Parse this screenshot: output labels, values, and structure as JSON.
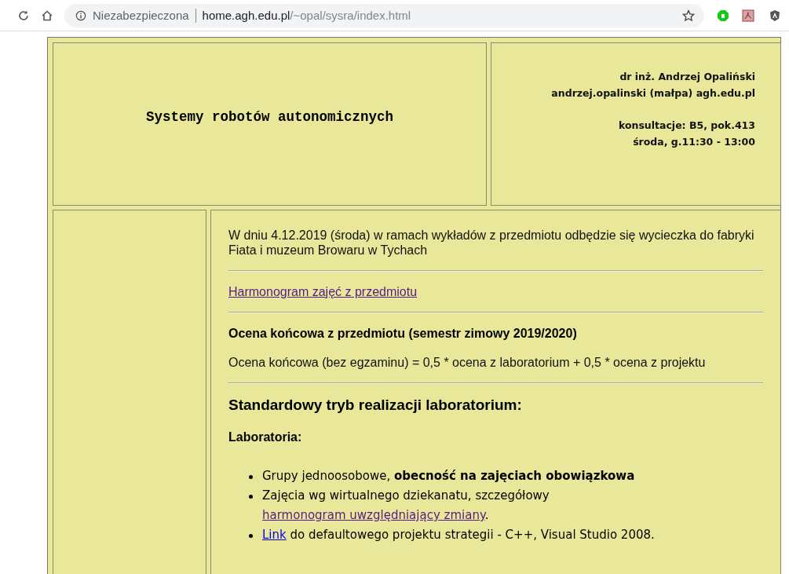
{
  "browser": {
    "security_label": "Niezabezpieczona",
    "url_host": "home.agh.edu.pl",
    "url_path": "/~opal/sysra/index.html"
  },
  "header": {
    "title": "Systemy robotów autonomicznych",
    "contact": [
      "dr inż. Andrzej Opaliński",
      "andrzej.opalinski (małpa) agh.edu.pl"
    ],
    "office_hours": [
      "konsultacje: B5, pok.413",
      "środa, g.11:30 - 13:00"
    ]
  },
  "content": [
    {
      "kind": "paragraph",
      "text": "W dniu 4.12.2019 (środa) w ramach wykładów z przedmiotu odbędzie się wycieczka do fabryki Fiata i muzeum Browaru w Tychach"
    },
    {
      "kind": "rule"
    },
    {
      "kind": "link",
      "text": "Harmonogram zajęć z przedmiotu",
      "visited": true
    },
    {
      "kind": "rule"
    },
    {
      "kind": "subheading",
      "text": "Ocena końcowa z przedmiotu (semestr zimowy 2019/2020)"
    },
    {
      "kind": "paragraph",
      "text": "Ocena końcowa (bez egzaminu) = 0,5 * ocena z laboratorium + 0,5 * ocena z projektu"
    },
    {
      "kind": "rule"
    },
    {
      "kind": "heading",
      "text": "Standardowy tryb realizacji laboratorium:"
    },
    {
      "kind": "subheading",
      "text": "Laboratoria:"
    },
    {
      "kind": "list",
      "items": [
        [
          {
            "kind": "plain",
            "text": "Grupy jednoosobowe, "
          },
          {
            "kind": "bold",
            "text": "obecność na zajęciach obowiązkowa"
          }
        ],
        [
          {
            "kind": "plain",
            "text": "Zajęcia wg wirtualnego dziekanatu, szczegółowy "
          },
          {
            "kind": "link",
            "text": "harmonogram uwzględniający zmiany",
            "visited": true
          },
          {
            "kind": "plain",
            "text": "."
          }
        ],
        [
          {
            "kind": "link",
            "text": "Link",
            "visited": false
          },
          {
            "kind": "plain",
            "text": " do defaultowego projektu strategii - C++, Visual Studio 2008."
          }
        ]
      ]
    }
  ]
}
